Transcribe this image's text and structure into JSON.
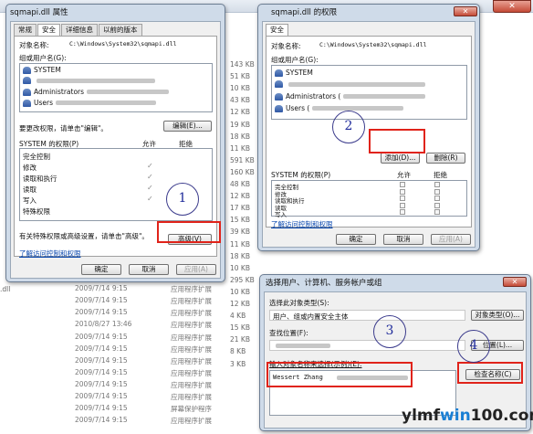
{
  "background": {
    "sizes": [
      "143 KB",
      "51 KB",
      "10 KB",
      "43 KB",
      "12 KB",
      "19 KB",
      "18 KB",
      "11 KB",
      "591 KB",
      "160 KB",
      "48 KB",
      "12 KB",
      "17 KB",
      "15 KB",
      "39 KB",
      "11 KB",
      "18 KB",
      "10 KB",
      "295 KB",
      "10 KB",
      "12 KB",
      "4 KB",
      "15 KB",
      "21 KB",
      "8 KB",
      "3 KB"
    ],
    "rows": [
      {
        "date": "2009/7/14 9:15",
        "type": "应用程序扩展"
      },
      {
        "date": "2009/7/14 9:15",
        "type": "应用程序扩展"
      },
      {
        "date": "2009/7/14 9:15",
        "type": "应用程序扩展"
      },
      {
        "date": "2009/7/14 9:15",
        "type": "应用程序扩展"
      },
      {
        "date": "2010/8/27 13:46",
        "type": "应用程序扩展"
      },
      {
        "date": "2009/7/14 9:15",
        "type": "应用程序扩展"
      },
      {
        "date": "2009/7/14 9:15",
        "type": "应用程序扩展"
      },
      {
        "date": "2009/7/14 9:15",
        "type": "应用程序扩展"
      },
      {
        "date": "2009/7/14 9:15",
        "type": "应用程序扩展"
      },
      {
        "date": "2009/7/14 9:15",
        "type": "应用程序扩展"
      },
      {
        "date": "2009/7/14 9:15",
        "type": "应用程序扩展"
      },
      {
        "date": "2009/7/14 9:15",
        "type": "屏幕保护程序"
      },
      {
        "date": "2009/7/14 9:15",
        "type": "应用程序扩展"
      }
    ],
    "left_fragment": ".dll",
    "close_glyph": "✕"
  },
  "props": {
    "title": "sqmapi.dll 属性",
    "tabs": [
      "常规",
      "安全",
      "详细信息",
      "以前的版本"
    ],
    "object_label": "对象名称:",
    "object_value": "C:\\Windows\\System32\\sqmapi.dll",
    "group_label": "组或用户名(G):",
    "users": [
      "SYSTEM",
      "",
      "Administrators",
      "Users"
    ],
    "change_hint": "要更改权限，请单击\"编辑\"。",
    "edit_btn": "编辑(E)...",
    "perm_header": "SYSTEM 的权限(P)",
    "allow": "允许",
    "deny": "拒绝",
    "perms": [
      "完全控制",
      "修改",
      "读取和执行",
      "读取",
      "写入",
      "特殊权限"
    ],
    "allowed": [
      false,
      true,
      true,
      true,
      true,
      false
    ],
    "special_hint": "有关特殊权限或高级设置，请单击\"高级\"。",
    "advanced_btn": "高级(V)",
    "learn_link": "了解访问控制和权限",
    "ok": "确定",
    "cancel": "取消",
    "apply": "应用(A)"
  },
  "perm": {
    "title": "sqmapi.dll 的权限",
    "tab": "安全",
    "object_label": "对象名称:",
    "object_value": "C:\\Windows\\System32\\sqmapi.dll",
    "group_label": "组或用户名(G):",
    "users": [
      "SYSTEM",
      "",
      "Administrators (",
      "Users ("
    ],
    "add_btn": "添加(D)...",
    "remove_btn": "删除(R)",
    "perm_header": "SYSTEM 的权限(P)",
    "allow": "允许",
    "deny": "拒绝",
    "perms": [
      "完全控制",
      "修改",
      "读取和执行",
      "读取",
      "写入"
    ],
    "learn_link": "了解访问控制和权限",
    "ok": "确定",
    "cancel": "取消",
    "apply": "应用(A)",
    "close_glyph": "✕"
  },
  "select": {
    "title": "选择用户、计算机、服务帐户或组",
    "type_label": "选择此对象类型(S):",
    "type_value": "用户、组或内置安全主体",
    "type_btn": "对象类型(O)...",
    "loc_label": "查找位置(F):",
    "loc_btn": "位置(L)...",
    "name_label": "输入对象名称来选择(示例)(E):",
    "name_value": "Wessert Zhang",
    "check_btn": "检查名称(C)",
    "close_glyph": "✕"
  },
  "steps": [
    "1",
    "2",
    "3",
    "4"
  ],
  "watermark": {
    "a": "ylmf",
    "b": "win",
    "c": "100.com"
  },
  "colors": {
    "annotation_red": "#e0231a",
    "annotation_circle": "#1e2a9a"
  }
}
